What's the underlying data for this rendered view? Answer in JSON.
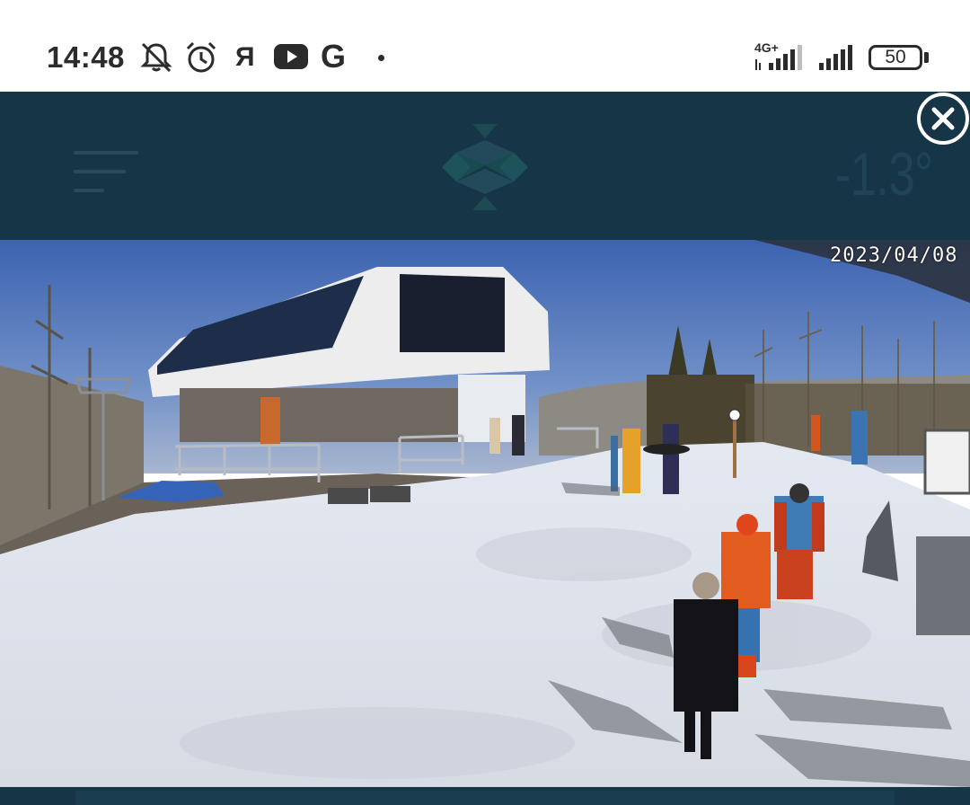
{
  "status_bar": {
    "time": "14:48",
    "icons": [
      "notifications-off-icon",
      "alarm-icon",
      "yandex-icon",
      "youtube-icon",
      "google-icon",
      "more-notifications-dot-icon"
    ],
    "yandex_glyph": "Я",
    "google_glyph": "G",
    "network_label": "4G+",
    "battery_level": "50"
  },
  "header": {
    "menu_icon": "hamburger-menu-icon",
    "logo_icon": "resort-snowflake-logo-icon",
    "temperature": "-1.3°",
    "close_icon": "close-circle-icon"
  },
  "webcam": {
    "timestamp": "2023/04/08"
  },
  "colors": {
    "header_bg": "#163547",
    "accent": "#1f4456",
    "snow": "#e9ecf2",
    "sky": "#4a6fb8"
  }
}
